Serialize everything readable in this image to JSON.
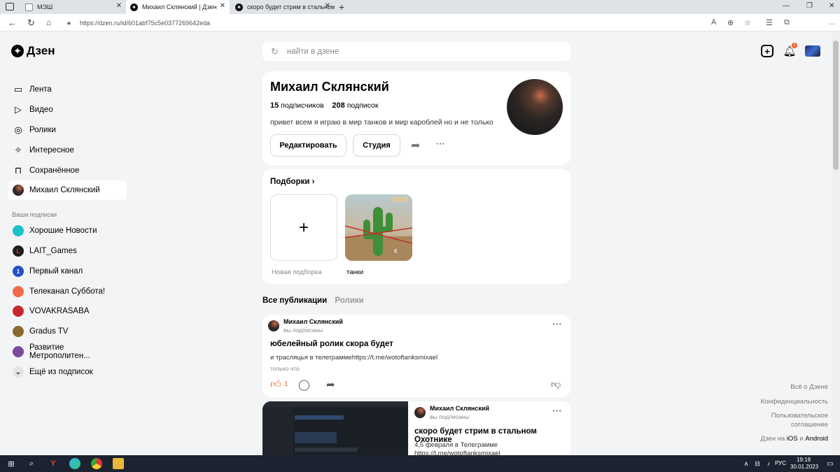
{
  "browser": {
    "tabs": [
      {
        "label": "МЭШ"
      },
      {
        "label": "Михаил Склянский | Дзен"
      },
      {
        "label": "скоро будет стрим в стальном"
      }
    ],
    "new_tab": "+",
    "url": "https://dzen.ru/id/601abf75c5e0377269642eda"
  },
  "logo": {
    "text": "Дзен"
  },
  "search": {
    "placeholder": "найти в дзене"
  },
  "notifications": {
    "count": "1"
  },
  "sidebar": {
    "items": [
      {
        "label": "Лента",
        "icon": "feed-icon"
      },
      {
        "label": "Видео",
        "icon": "play-icon"
      },
      {
        "label": "Ролики",
        "icon": "shorts-icon"
      },
      {
        "label": "Интересное",
        "icon": "sparkle-icon"
      },
      {
        "label": "Сохранённое",
        "icon": "bookmark-icon"
      },
      {
        "label": "Михаил Склянский",
        "icon": "avatar"
      }
    ],
    "subs_header": "Ваши подписки",
    "subs": [
      {
        "label": "Хорошие Новости",
        "color": "#19c1c9"
      },
      {
        "label": "LAIT_Games",
        "color": "#d63a1e"
      },
      {
        "label": "Первый канал",
        "color": "#2450c8"
      },
      {
        "label": "Телеканал Суббота!",
        "color": "#f06b47"
      },
      {
        "label": "VOVAKRASABA",
        "color": "#c9262e"
      },
      {
        "label": "Gradus TV",
        "color": "#8a6a2e"
      },
      {
        "label": "Развитие Метрополитен...",
        "color": "#7a4a9e"
      }
    ],
    "more": "Ещё из подписок"
  },
  "profile": {
    "name": "Михаил Склянский",
    "subscribers_count": "15",
    "subscribers_label": "подписчиков",
    "subscriptions_count": "208",
    "subscriptions_label": "подписок",
    "description": "привет всем я играю в мир танков и мир кароблей но и не только",
    "edit_button": "Редактировать",
    "studio_button": "Студия",
    "more": "···"
  },
  "collections": {
    "title": "Подборки",
    "new_label": "Новая подборка",
    "items": [
      {
        "label": "танки",
        "count": "6"
      }
    ]
  },
  "feed_tabs": [
    {
      "label": "Все публикации"
    },
    {
      "label": "Ролики"
    }
  ],
  "posts": [
    {
      "author": "Михаил Склянский",
      "sub": "вы подписаны",
      "title": "юбелейный ролик скора будет",
      "text": "и трасляцья в телеграммеhttps://t.me/wotoftanksmixael",
      "time": "только что",
      "likes": "1"
    },
    {
      "author": "Михаил Склянский",
      "sub": "вы подписаны",
      "title": "скоро будет стрим в стальном Охотнике",
      "text1": "4,5 февраля в Телеграмме",
      "text2": "https://t.me/wotoftanksmixael"
    }
  ],
  "footer": [
    {
      "label": "Всё о Дзене"
    },
    {
      "label": "Конфиденциальность"
    },
    {
      "label": "Пользовательское"
    },
    {
      "label": "соглашение"
    },
    {
      "label": "Дзен на "
    },
    {
      "label": "iOS"
    },
    {
      "label": " и "
    },
    {
      "label": "Android"
    }
  ],
  "taskbar": {
    "lang": "РУС",
    "time": "19:18",
    "date": "30.01.2023"
  }
}
